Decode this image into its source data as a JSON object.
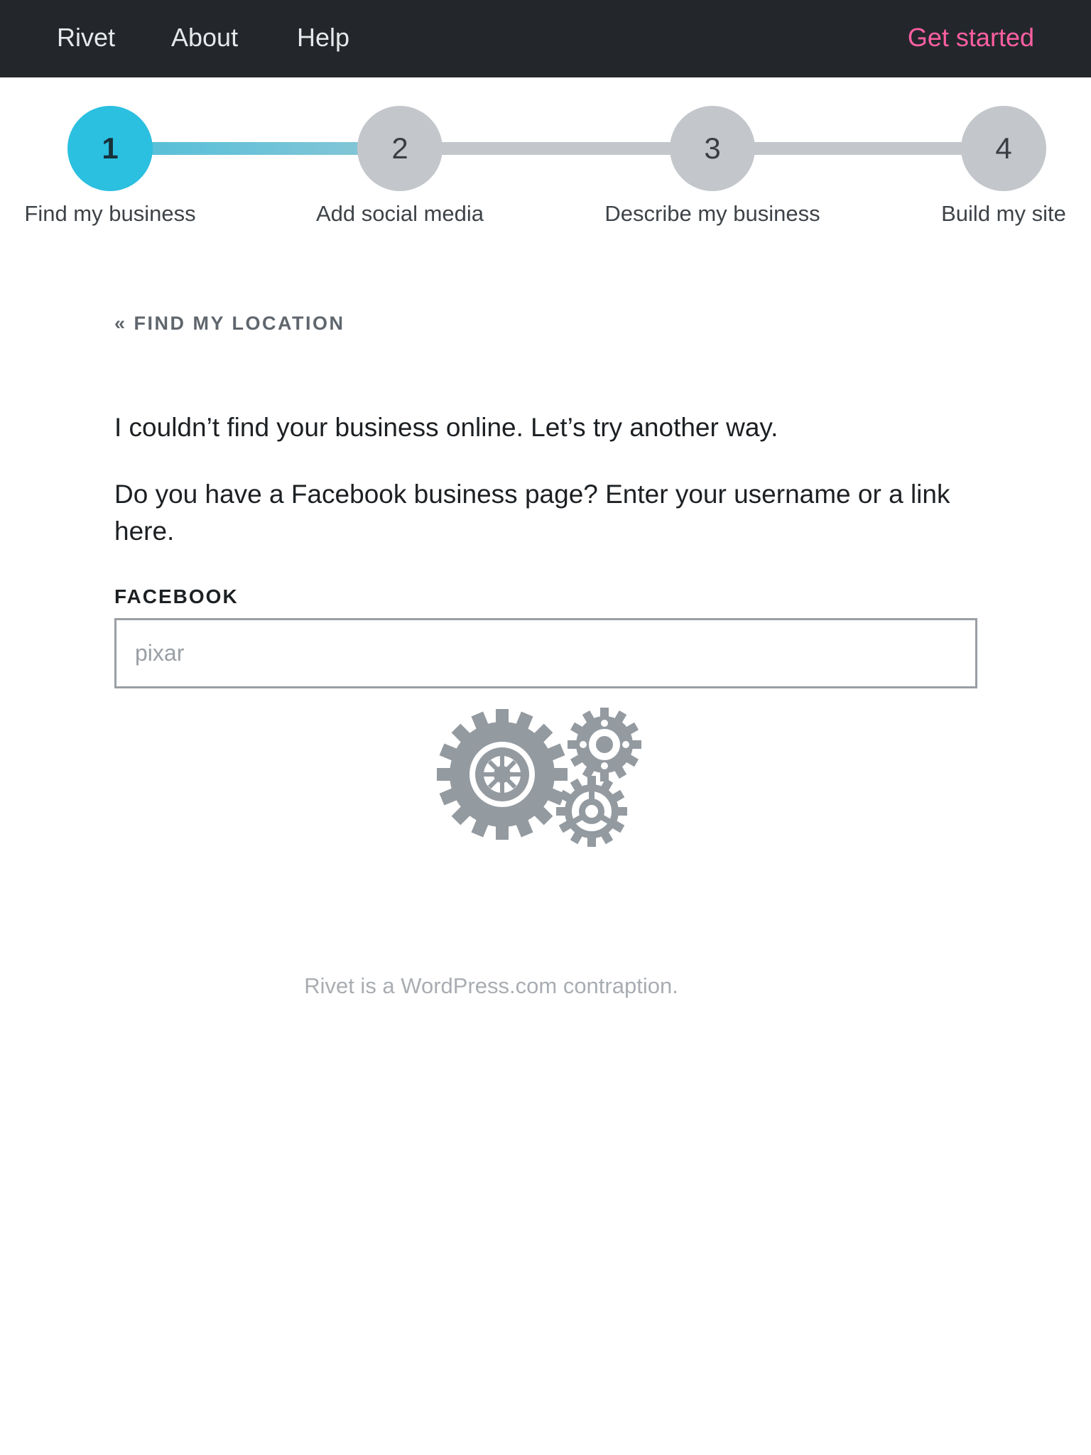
{
  "nav": {
    "brand": "Rivet",
    "links": [
      "About",
      "Help"
    ],
    "cta": "Get started"
  },
  "colors": {
    "nav_bg": "#23272b",
    "cta": "#ff5fa2",
    "step_active": "#2bbfe0",
    "step_inactive": "#c3c6ca"
  },
  "steps": [
    {
      "number": "1",
      "label": "Find my business",
      "active": true
    },
    {
      "number": "2",
      "label": "Add social media",
      "active": false
    },
    {
      "number": "3",
      "label": "Describe my business",
      "active": false
    },
    {
      "number": "4",
      "label": "Build my site",
      "active": false
    }
  ],
  "main": {
    "back_link": "« FIND MY LOCATION",
    "intro": "I couldn’t find your business online. Let’s try another way.",
    "prompt": "Do you have a Facebook business page? Enter your username or a link here.",
    "field_label": "FACEBOOK",
    "field_placeholder": "pixar",
    "field_value": ""
  },
  "loading_icon": "gears-icon",
  "footer": "Rivet is a WordPress.com contraption."
}
